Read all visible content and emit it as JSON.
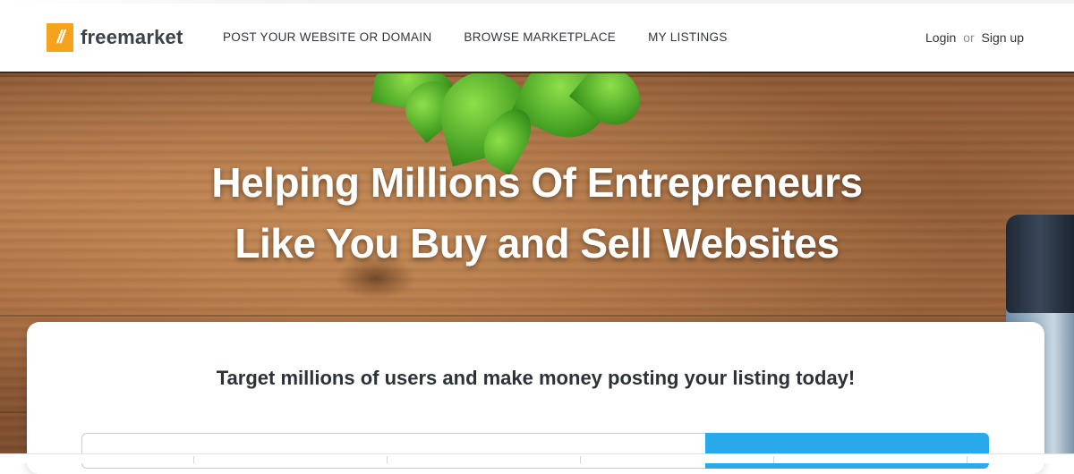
{
  "header": {
    "logo_mark": "//",
    "logo_text": "freemarket",
    "nav": [
      {
        "label": "POST YOUR WEBSITE OR DOMAIN"
      },
      {
        "label": "BROWSE MARKETPLACE"
      },
      {
        "label": "MY LISTINGS"
      }
    ],
    "login_label": "Login",
    "or_label": "or",
    "signup_label": "Sign up"
  },
  "hero": {
    "headline_line1": "Helping Millions Of Entrepreneurs",
    "headline_line2": "Like You Buy and Sell Websites"
  },
  "card": {
    "tagline": "Target millions of users and make money posting your listing today!",
    "search_value": "",
    "button_label": ""
  },
  "colors": {
    "brand_orange": "#f5a21c",
    "button_blue": "#2aa9ea",
    "text_dark": "#2c3238"
  }
}
